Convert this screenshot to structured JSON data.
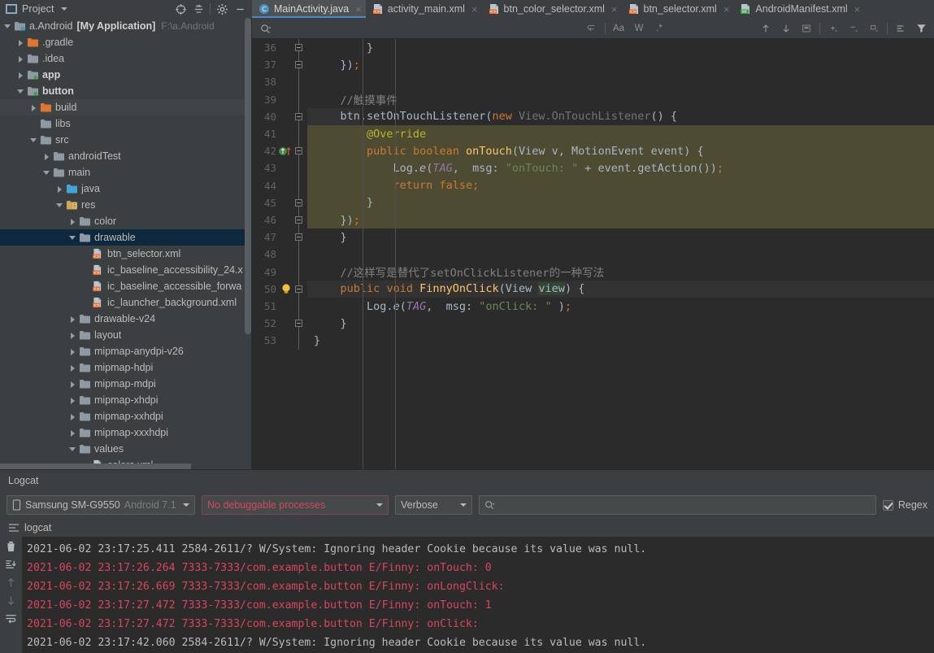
{
  "project_panel": {
    "title": "Project",
    "icon": "project-icon",
    "dropdown_icon": "chevron-down-icon",
    "tools": [
      "target-icon",
      "collapse-all-icon",
      "gear-icon",
      "minimize-icon"
    ]
  },
  "tabs": [
    {
      "label": "MainActivity.java",
      "icon": "java-class-icon",
      "active": true,
      "close": "×"
    },
    {
      "label": "activity_main.xml",
      "icon": "xml-layout-icon",
      "active": false,
      "close": "×"
    },
    {
      "label": "btn_color_selector.xml",
      "icon": "xml-layout-icon",
      "active": false,
      "close": "×"
    },
    {
      "label": "btn_selector.xml",
      "icon": "xml-layout-icon",
      "active": false,
      "close": "×"
    },
    {
      "label": "AndroidManifest.xml",
      "icon": "xml-manifest-icon",
      "active": false,
      "close": "×"
    }
  ],
  "tree": [
    {
      "label": "a.Android",
      "extra": "[My Application]",
      "path": "F:\\a.Android",
      "indent": 0,
      "arrow": "down",
      "icon": "module-icon",
      "state": "normal"
    },
    {
      "label": ".gradle",
      "indent": 1,
      "arrow": "right",
      "icon": "folder-orange-icon",
      "state": "normal"
    },
    {
      "label": ".idea",
      "indent": 1,
      "arrow": "right",
      "icon": "folder-icon",
      "state": "normal"
    },
    {
      "label": "app",
      "indent": 1,
      "arrow": "right",
      "icon": "module-green-icon",
      "state": "bold"
    },
    {
      "label": "button",
      "indent": 1,
      "arrow": "down",
      "icon": "module-green-icon",
      "state": "bold"
    },
    {
      "label": "build",
      "indent": 2,
      "arrow": "right",
      "icon": "folder-orange-icon",
      "state": "hover"
    },
    {
      "label": "libs",
      "indent": 2,
      "arrow": "none",
      "icon": "folder-icon",
      "state": "normal"
    },
    {
      "label": "src",
      "indent": 2,
      "arrow": "down",
      "icon": "folder-icon",
      "state": "normal"
    },
    {
      "label": "androidTest",
      "indent": 3,
      "arrow": "right",
      "icon": "folder-icon",
      "state": "normal"
    },
    {
      "label": "main",
      "indent": 3,
      "arrow": "down",
      "icon": "folder-icon",
      "state": "normal"
    },
    {
      "label": "java",
      "indent": 4,
      "arrow": "right",
      "icon": "folder-java-icon",
      "state": "normal"
    },
    {
      "label": "res",
      "indent": 4,
      "arrow": "down",
      "icon": "folder-res-icon",
      "state": "normal"
    },
    {
      "label": "color",
      "indent": 5,
      "arrow": "right",
      "icon": "folder-icon",
      "state": "normal"
    },
    {
      "label": "drawable",
      "indent": 5,
      "arrow": "down",
      "icon": "folder-icon",
      "state": "selected"
    },
    {
      "label": "btn_selector.xml",
      "indent": 6,
      "arrow": "none",
      "icon": "xml-layout-icon",
      "state": "normal"
    },
    {
      "label": "ic_baseline_accessibility_24.x",
      "indent": 6,
      "arrow": "none",
      "icon": "xml-layout-icon",
      "state": "normal"
    },
    {
      "label": "ic_baseline_accessible_forwa",
      "indent": 6,
      "arrow": "none",
      "icon": "xml-layout-icon",
      "state": "normal"
    },
    {
      "label": "ic_launcher_background.xml",
      "indent": 6,
      "arrow": "none",
      "icon": "xml-layout-icon",
      "state": "normal"
    },
    {
      "label": "drawable-v24",
      "indent": 5,
      "arrow": "right",
      "icon": "folder-icon",
      "state": "normal"
    },
    {
      "label": "layout",
      "indent": 5,
      "arrow": "right",
      "icon": "folder-icon",
      "state": "normal"
    },
    {
      "label": "mipmap-anydpi-v26",
      "indent": 5,
      "arrow": "right",
      "icon": "folder-icon",
      "state": "normal"
    },
    {
      "label": "mipmap-hdpi",
      "indent": 5,
      "arrow": "right",
      "icon": "folder-icon",
      "state": "normal"
    },
    {
      "label": "mipmap-mdpi",
      "indent": 5,
      "arrow": "right",
      "icon": "folder-icon",
      "state": "normal"
    },
    {
      "label": "mipmap-xhdpi",
      "indent": 5,
      "arrow": "right",
      "icon": "folder-icon",
      "state": "normal"
    },
    {
      "label": "mipmap-xxhdpi",
      "indent": 5,
      "arrow": "right",
      "icon": "folder-icon",
      "state": "normal"
    },
    {
      "label": "mipmap-xxxhdpi",
      "indent": 5,
      "arrow": "right",
      "icon": "folder-icon",
      "state": "normal"
    },
    {
      "label": "values",
      "indent": 5,
      "arrow": "down",
      "icon": "folder-icon",
      "state": "normal"
    },
    {
      "label": "colors.xml",
      "indent": 6,
      "arrow": "none",
      "icon": "xml-layout-icon",
      "state": "normal"
    }
  ],
  "find_toolbar": {
    "search_placeholder": "",
    "buttons": [
      "regex-toggle-icon",
      "match-case-icon",
      "words-icon",
      "regex-icon",
      "prev-occurrence-icon",
      "next-occurrence-icon",
      "select-all-icon",
      "add-icon",
      "remove-icon",
      "edit-icon",
      "expand-icon",
      "filter-icon"
    ],
    "match_case_label": "Aa",
    "words_label": "W",
    "regex_label": ".*"
  },
  "code": {
    "first_line": 36,
    "lines": [
      {
        "n": 36,
        "fold": "end",
        "html": "        }"
      },
      {
        "n": 37,
        "fold": "end",
        "html": "    });"
      },
      {
        "n": 38,
        "fold": "none",
        "html": ""
      },
      {
        "n": 39,
        "fold": "none",
        "html": "    //触摸事件"
      },
      {
        "n": 40,
        "fold": "start",
        "html": "    btn.setOnTouchListener(new View.OnTouchListener() {"
      },
      {
        "n": 41,
        "fold": "none",
        "html": "        @Override"
      },
      {
        "n": 42,
        "fold": "start",
        "html": "        public boolean onTouch(View v, MotionEvent event) {"
      },
      {
        "n": 43,
        "fold": "none",
        "html": "            Log.e(TAG,  msg: \"onTouch: \" + event.getAction());"
      },
      {
        "n": 44,
        "fold": "none",
        "html": "            return false;"
      },
      {
        "n": 45,
        "fold": "end",
        "html": "        }"
      },
      {
        "n": 46,
        "fold": "end",
        "html": "    });"
      },
      {
        "n": 47,
        "fold": "end",
        "html": "    }"
      },
      {
        "n": 48,
        "fold": "none",
        "html": ""
      },
      {
        "n": 49,
        "fold": "none",
        "html": "    //这样写是替代了setOnClickListener的一种写法"
      },
      {
        "n": 50,
        "fold": "start",
        "html": "    public void FinnyOnClick(View view) {"
      },
      {
        "n": 51,
        "fold": "none",
        "html": "        Log.e(TAG,  msg: \"onClick: \" );"
      },
      {
        "n": 52,
        "fold": "end",
        "html": "    }"
      },
      {
        "n": 53,
        "fold": "none",
        "html": "}"
      }
    ],
    "gutter_icons": {
      "42": "override-method-icon",
      "50": "intention-bulb-icon"
    },
    "current_line": 50,
    "highlight_block": {
      "from": 41,
      "to": 46
    }
  },
  "logcat": {
    "title": "Logcat",
    "device": {
      "name": "Samsung SM-G9550",
      "os": "Android 7.1",
      "icon": "phone-icon"
    },
    "process": "No debuggable processes",
    "level": "Verbose",
    "search_placeholder": "",
    "search_icon": "search-icon",
    "regex_label": "Regex",
    "regex_checked": true,
    "tab_label": "logcat",
    "tab_icon": "logcat-icon",
    "side_icons": [
      "trash-icon",
      "scroll-to-end-icon",
      "up-arrow-icon",
      "down-arrow-icon",
      "soft-wrap-icon"
    ],
    "lines": [
      {
        "level": "W",
        "text": "2021-06-02 23:17:25.411 2584-2611/? W/System: Ignoring header Cookie because its value was null."
      },
      {
        "level": "E",
        "text": "2021-06-02 23:17:26.264 7333-7333/com.example.button E/Finny: onTouch: 0"
      },
      {
        "level": "E",
        "text": "2021-06-02 23:17:26.669 7333-7333/com.example.button E/Finny: onLongClick:"
      },
      {
        "level": "E",
        "text": "2021-06-02 23:17:27.472 7333-7333/com.example.button E/Finny: onTouch: 1"
      },
      {
        "level": "E",
        "text": "2021-06-02 23:17:27.472 7333-7333/com.example.button E/Finny: onClick:"
      },
      {
        "level": "W",
        "text": "2021-06-02 23:17:42.060 2584-2611/? W/System: Ignoring header Cookie because its value was null."
      }
    ]
  },
  "colors": {
    "bg_panel": "#3c3f41",
    "bg_editor": "#2b2b2b",
    "accent_tab": "#4a88c7",
    "selection": "#0d293e",
    "highlight_block": "#4d4b31",
    "error_red": "#d9455f",
    "keyword": "#cc7832",
    "string": "#6a8759",
    "method": "#ffc66d",
    "field": "#9876aa",
    "comment": "#808080"
  }
}
